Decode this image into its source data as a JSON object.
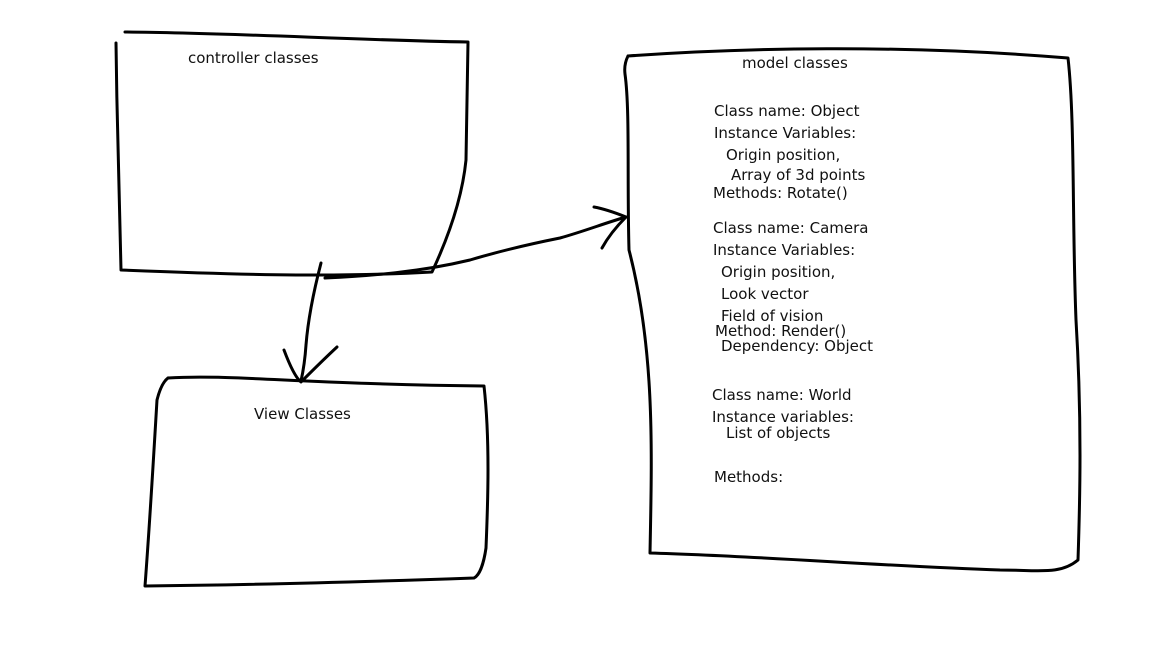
{
  "diagram": {
    "stroke_color": "#000000",
    "background": "#ffffff",
    "boxes": {
      "controller": {
        "title": "controller classes"
      },
      "view": {
        "title": "View Classes"
      },
      "model": {
        "title": "model classes",
        "lines": [
          "Class name: Object",
          "Instance Variables:",
          "Origin position,",
          "Array of 3d points",
          "Methods: Rotate()",
          "Class name: Camera",
          "Instance Variables:",
          "Origin position,",
          "Look vector",
          "Field of vision",
          "Method: Render()",
          "Dependency: Object",
          "Class name: World",
          "Instance variables:",
          "List of objects",
          "Methods:"
        ]
      }
    },
    "arrows": [
      {
        "from": "controller",
        "to": "view"
      },
      {
        "from": "controller",
        "to": "model"
      }
    ]
  }
}
